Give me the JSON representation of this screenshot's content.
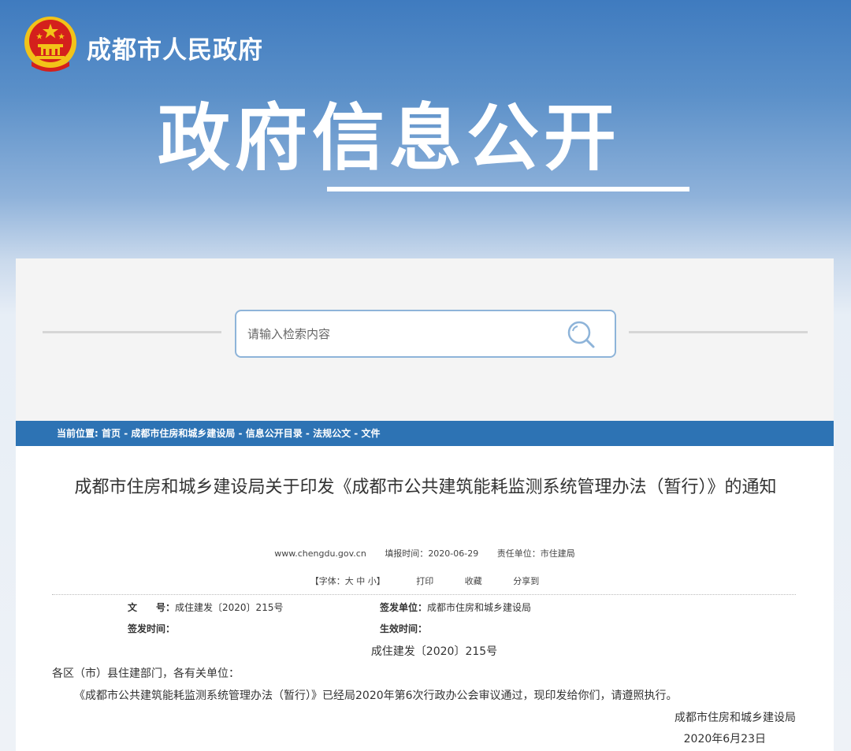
{
  "header": {
    "site_name": "成都市人民政府",
    "banner_title": "政府信息公开"
  },
  "search": {
    "placeholder": "请输入检索内容"
  },
  "breadcrumb": {
    "prefix": "当前位置:",
    "items": [
      "首页",
      "成都市住房和城乡建设局",
      "信息公开目录",
      "法规公文",
      "文件"
    ],
    "separator": " - "
  },
  "article": {
    "title": "成都市住房和城乡建设局关于印发《成都市公共建筑能耗监测系统管理办法（暂行）》的通知",
    "meta": {
      "source": "www.chengdu.gov.cn",
      "date_label": "填报时间：",
      "date": "2020-06-29",
      "unit_label": "责任单位：",
      "unit": "市住建局"
    },
    "tools": {
      "font_size": "【字体：大 中 小】",
      "print": "打印",
      "favorite": "收藏",
      "share": "分享到"
    },
    "info": {
      "doc_no_label": "文　　号：",
      "doc_no": "成住建发〔2020〕215号",
      "issuer_label": "签发单位：",
      "issuer": "成都市住房和城乡建设局",
      "issue_time_label": "签发时间：",
      "issue_time": "",
      "effective_label": "生效时间：",
      "effective": ""
    },
    "doc_number": "成住建发〔2020〕215号",
    "salutation": "各区（市）县住建部门，各有关单位：",
    "paragraph": "《成都市公共建筑能耗监测系统管理办法（暂行）》已经局2020年第6次行政办公会审议通过，现印发给你们，请遵照执行。",
    "signature": "成都市住房和城乡建设局",
    "sign_date": "2020年6月23日"
  },
  "colors": {
    "breadcrumb_bg": "#2d73b4",
    "search_border": "#8eb4d9",
    "emblem_red": "#d4201c",
    "emblem_gold": "#f2c318"
  }
}
